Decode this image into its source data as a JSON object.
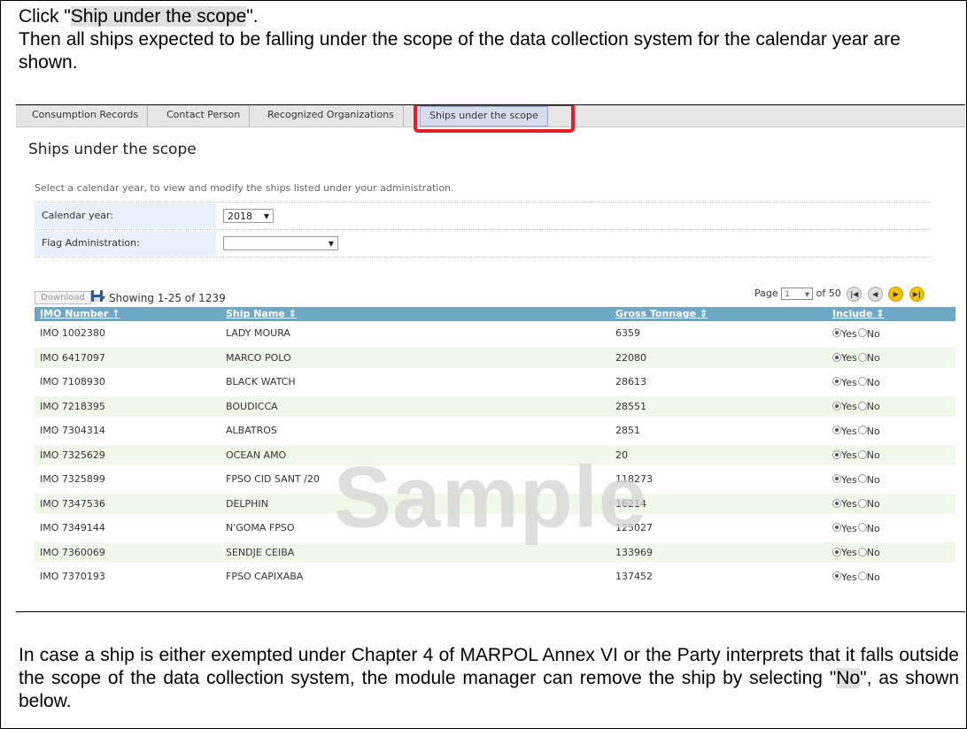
{
  "top_note": {
    "line1_prefix": "Click \"",
    "line1_highlight": "Ship under the scope",
    "line1_suffix": "\".",
    "line2": "Then all ships expected to be falling under the scope of the data collection system for the calendar year are shown."
  },
  "tabs": [
    {
      "label": "Consumption Records"
    },
    {
      "label": "Contact Person"
    },
    {
      "label": "Recognized Organizations"
    },
    {
      "label": "Ships under the scope",
      "active": true
    }
  ],
  "page_title": "Ships under the scope",
  "intro_text": "Select a calendar year, to view and modify the ships listed under your administration.",
  "form": {
    "calendar_year_label": "Calendar year:",
    "calendar_year_value": "2018",
    "flag_label": "Flag Administration:",
    "flag_value": ""
  },
  "toolbar": {
    "download_label": "Download",
    "showing_text": "Showing 1-25 of 1239",
    "page_label": "Page",
    "page_value": "1",
    "of_text": "of 50"
  },
  "table": {
    "headers": {
      "imo": "IMO Number ↑",
      "name": "Ship Name ⇕",
      "gt": "Gross Tonnage ⇕",
      "include": "Include ⇕"
    },
    "yes_label": "Yes",
    "no_label": "No",
    "rows": [
      {
        "imo": "IMO 1002380",
        "name": "LADY MOURA",
        "gt": "6359"
      },
      {
        "imo": "IMO 6417097",
        "name": "MARCO POLO",
        "gt": "22080"
      },
      {
        "imo": "IMO 7108930",
        "name": "BLACK WATCH",
        "gt": "28613"
      },
      {
        "imo": "IMO 7218395",
        "name": "BOUDICCA",
        "gt": "28551"
      },
      {
        "imo": "IMO 7304314",
        "name": "ALBATROS",
        "gt": "2851"
      },
      {
        "imo": "IMO 7325629",
        "name": "OCEAN AMO",
        "gt": "20"
      },
      {
        "imo": "IMO 7325899",
        "name": "FPSO CID SANT /20",
        "gt": "118273"
      },
      {
        "imo": "IMO 7347536",
        "name": "DELPHIN",
        "gt": "16214"
      },
      {
        "imo": "IMO 7349144",
        "name": "N'GOMA FPSO",
        "gt": "125027"
      },
      {
        "imo": "IMO 7360069",
        "name": "SENDJE CEIBA",
        "gt": "133969"
      },
      {
        "imo": "IMO 7370193",
        "name": "FPSO CAPIXABA",
        "gt": "137452"
      }
    ]
  },
  "watermark": "Sample",
  "bottom_note": {
    "text_prefix": "In case a ship is either exempted under Chapter 4 of MARPOL Annex VI or the Party interprets that it falls outside the scope of the data collection system, the module manager can remove the ship by selecting \"",
    "highlight": "No",
    "text_suffix": "\", as shown below."
  },
  "colors": {
    "table_header": "#6fa8c7",
    "callout_red": "#e21e26",
    "row_alt": "#f0f8ea",
    "label_bg": "#e8f0fb"
  }
}
